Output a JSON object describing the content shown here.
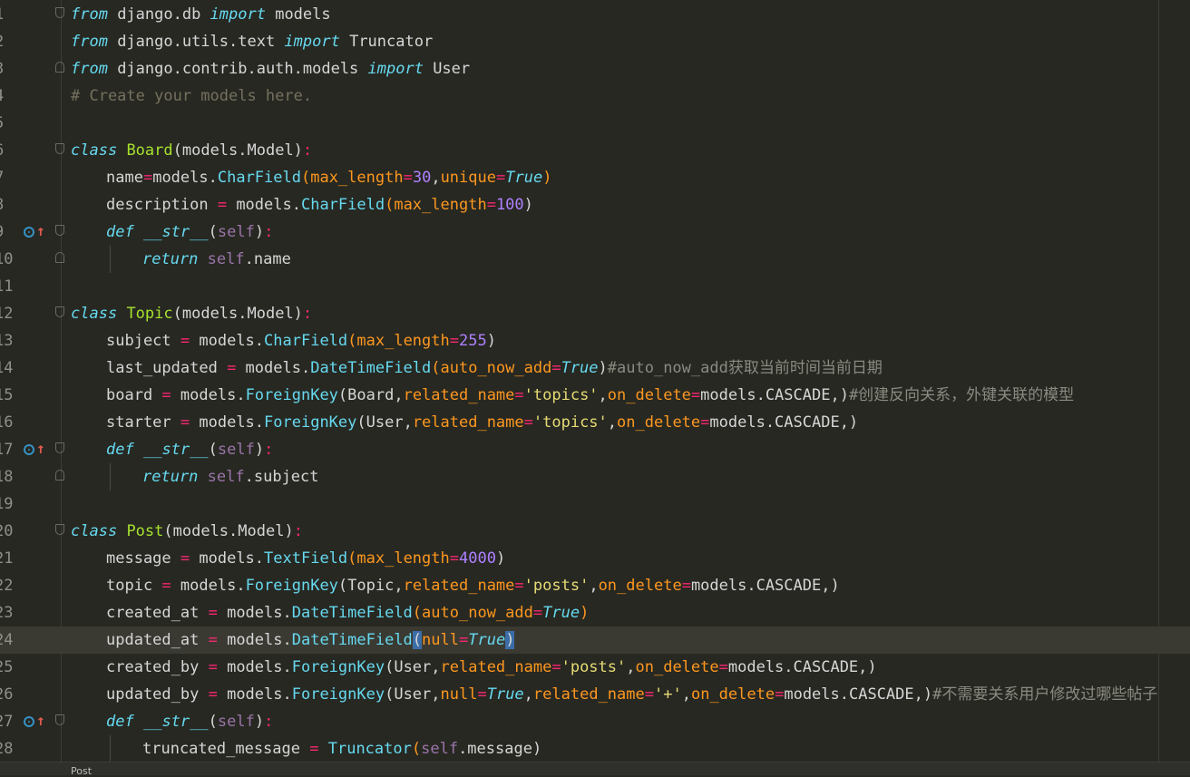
{
  "editor": {
    "current_line": 24,
    "lines": [
      {
        "n": "1",
        "html": "<span class='kw-i'>from</span> django.db <span class='kw-i'>import</span> models"
      },
      {
        "n": "2",
        "html": "<span class='kw-i'>from</span> django.utils.text <span class='kw-i'>import</span> Truncator"
      },
      {
        "n": "3",
        "html": "<span class='kw-i'>from</span> django.contrib.auth.models <span class='kw-i'>import</span> User"
      },
      {
        "n": "4",
        "html": "<span class='cmt'># Create your models here.</span>"
      },
      {
        "n": "5",
        "html": ""
      },
      {
        "n": "6",
        "html": "<span class='kw-i'>class</span> <span class='cls'>Board</span>(models.Model)<span class='op'>:</span>"
      },
      {
        "n": "7",
        "html": "name<span class='op'>=</span>models.<span class='call'>CharField</span><span class='param'>(max_length</span><span class='op'>=</span><span class='num'>30</span>,<span class='param'>unique</span><span class='op'>=</span><span class='true'>True</span><span class='param'>)</span>"
      },
      {
        "n": "8",
        "html": "description <span class='op'>=</span> models.<span class='call'>CharField</span><span class='param'>(max_length</span><span class='op'>=</span><span class='num'>100</span>)"
      },
      {
        "n": "9",
        "html": "<span class='fn'>def</span> <span class='fn'>__str__</span>(<span class='self'>self</span>)<span class='op'>:</span>"
      },
      {
        "n": "10",
        "html": "<span class='kw-r'>return</span> <span class='self'>self</span>.name"
      },
      {
        "n": "11",
        "html": ""
      },
      {
        "n": "12",
        "html": "<span class='kw-i'>class</span> <span class='cls'>Topic</span>(models.Model)<span class='op'>:</span>"
      },
      {
        "n": "13",
        "html": "subject <span class='op'>=</span> models.<span class='call'>CharField</span><span class='param'>(max_length</span><span class='op'>=</span><span class='num'>255</span>)"
      },
      {
        "n": "14",
        "html": "last_updated <span class='op'>=</span> models.<span class='call'>DateTimeField</span><span class='param'>(auto_now_add</span><span class='op'>=</span><span class='true'>True</span>)<span class='cmt-cn'>#auto_now_add获取当前时间当前日期</span>"
      },
      {
        "n": "15",
        "html": "board <span class='op'>=</span> models.<span class='call'>ForeignKey</span>(Board,<span class='param'>related_name</span><span class='op'>=</span><span class='str'>'topics'</span>,<span class='param'>on_delete</span><span class='op'>=</span>models.CASCADE,)<span class='cmt-cn'>#创建反向关系，外键关联的模型</span>"
      },
      {
        "n": "16",
        "html": "starter <span class='op'>=</span> models.<span class='call'>ForeignKey</span>(User,<span class='param'>related_name</span><span class='op'>=</span><span class='str'>'topics'</span>,<span class='param'>on_delete</span><span class='op'>=</span>models.CASCADE,)"
      },
      {
        "n": "17",
        "html": "<span class='fn'>def</span> <span class='fn'>__str__</span>(<span class='self'>self</span>)<span class='op'>:</span>"
      },
      {
        "n": "18",
        "html": "<span class='kw-r'>return</span> <span class='self'>self</span>.subject"
      },
      {
        "n": "19",
        "html": ""
      },
      {
        "n": "20",
        "html": "<span class='kw-i'>class</span> <span class='cls'>Post</span>(models.Model)<span class='op'>:</span>"
      },
      {
        "n": "21",
        "html": "message <span class='op'>=</span> models.<span class='call'>TextField</span><span class='param'>(max_length</span><span class='op'>=</span><span class='num'>4000</span>)"
      },
      {
        "n": "22",
        "html": "topic <span class='op'>=</span> models.<span class='call'>ForeignKey</span>(Topic,<span class='param'>related_name</span><span class='op'>=</span><span class='str'>'posts'</span>,<span class='param'>on_delete</span><span class='op'>=</span>models.CASCADE,)"
      },
      {
        "n": "23",
        "html": "created_at <span class='op'>=</span> models.<span class='call'>DateTimeField</span><span class='param'>(auto_now_add</span><span class='op'>=</span><span class='true'>True</span><span class='param'>)</span>"
      },
      {
        "n": "24",
        "html": "updated_at <span class='op'>=</span> models.<span class='call'>DateTimeField</span><span class='hl-paren'>(</span><span class='param'>null</span><span class='op'>=</span><span class='true'>True</span><span class='hl-paren'>)</span>"
      },
      {
        "n": "25",
        "html": "created_by <span class='op'>=</span> models.<span class='call'>ForeignKey</span>(User,<span class='param'>related_name</span><span class='op'>=</span><span class='str'>'posts'</span>,<span class='param'>on_delete</span><span class='op'>=</span>models.CASCADE,)"
      },
      {
        "n": "26",
        "html": "updated_by <span class='op'>=</span> models.<span class='call'>ForeignKey</span>(User,<span class='param'>null</span><span class='op'>=</span><span class='true'>True</span>,<span class='param'>related_name</span><span class='op'>=</span><span class='str'>'+'</span>,<span class='param'>on_delete</span><span class='op'>=</span>models.CASCADE,)<span class='cmt-cn'>#不需要关系用户修改过哪些帖子</span>"
      },
      {
        "n": "27",
        "html": "<span class='fn'>def</span> <span class='fn'>__str__</span>(<span class='self'>self</span>)<span class='op'>:</span>"
      },
      {
        "n": "28",
        "html": "truncated_message <span class='op'>=</span> <span class='call'>Truncator</span><span class='param'>(</span><span class='self'>self</span>.message)"
      }
    ]
  },
  "statusbar": {
    "breadcrumb": "Post"
  }
}
